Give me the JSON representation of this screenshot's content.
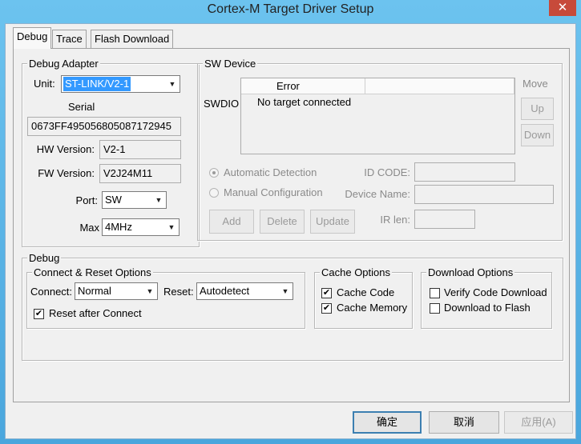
{
  "window": {
    "title": "Cortex-M Target Driver Setup",
    "close_glyph": "✕"
  },
  "tabs": [
    "Debug",
    "Trace",
    "Flash Download"
  ],
  "debug_adapter": {
    "title": "Debug Adapter",
    "unit_label": "Unit:",
    "unit_value": "ST-LINK/V2-1",
    "serial_label": "Serial",
    "serial_value": "0673FF495056805087172945",
    "hw_label": "HW Version:",
    "hw_value": "V2-1",
    "fw_label": "FW Version:",
    "fw_value": "V2J24M11",
    "port_label": "Port:",
    "port_value": "SW",
    "max_label": "Max",
    "max_value": "4MHz"
  },
  "sw_device": {
    "title": "SW Device",
    "swdio_label": "SWDIO",
    "col_error": "Error",
    "row_text": "No target connected",
    "move_label": "Move",
    "up_label": "Up",
    "down_label": "Down",
    "auto_detection": "Automatic Detection",
    "manual_config": "Manual Configuration",
    "id_code_label": "ID CODE:",
    "device_name_label": "Device Name:",
    "ir_len_label": "IR len:",
    "add_label": "Add",
    "delete_label": "Delete",
    "update_label": "Update"
  },
  "debug": {
    "title": "Debug",
    "connect_reset": {
      "title": "Connect & Reset Options",
      "connect_label": "Connect:",
      "connect_value": "Normal",
      "reset_label": "Reset:",
      "reset_value": "Autodetect",
      "reset_after_connect": "Reset after Connect",
      "reset_after_connect_checked": true
    },
    "cache": {
      "title": "Cache Options",
      "cache_code": "Cache Code",
      "cache_code_checked": true,
      "cache_memory": "Cache Memory",
      "cache_memory_checked": true
    },
    "download": {
      "title": "Download Options",
      "verify": "Verify Code Download",
      "verify_checked": false,
      "to_flash": "Download to Flash",
      "to_flash_checked": false
    }
  },
  "footer": {
    "ok": "确定",
    "cancel": "取消",
    "apply": "应用(A)"
  },
  "glyphs": {
    "check": "✔",
    "dropdown": "▼"
  }
}
